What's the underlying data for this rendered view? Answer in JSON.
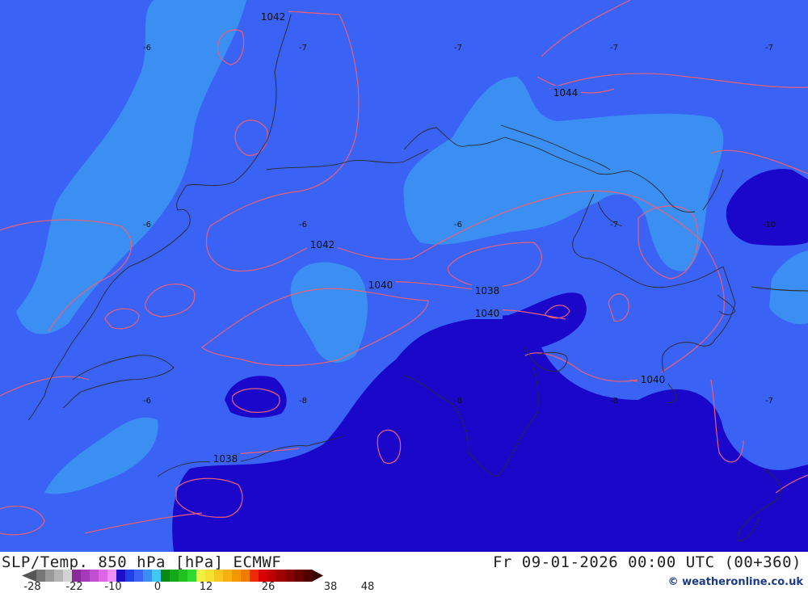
{
  "title_left": "SLP/Temp. 850 hPa [hPa] ECMWF",
  "title_right": "Fr 09-01-2026 00:00 UTC (00+360)",
  "copyright": "© weatheronline.co.uk",
  "colors": {
    "band_minus10_minus6": "#3a62f5",
    "band_minus6_minus4": "#3b8ff2",
    "band_minus12_minus10": "#1a07c9",
    "isobar": "#e8607a",
    "coastline": "#2a2a2a"
  },
  "scale": {
    "colors": [
      "#777777",
      "#999999",
      "#b4b4b4",
      "#d2d2d2",
      "#8a2a9a",
      "#a43ab8",
      "#c24fd2",
      "#dc66e6",
      "#f090f4",
      "#1e0ec8",
      "#2040e6",
      "#3a62f5",
      "#3b8ff2",
      "#40c8f4",
      "#0a8a14",
      "#12a818",
      "#20c020",
      "#30d830",
      "#f0f040",
      "#f6e030",
      "#f8c820",
      "#f8b010",
      "#f49800",
      "#f07c00",
      "#ee2a00",
      "#d80000",
      "#bc0000",
      "#a00000",
      "#860000",
      "#6a0000",
      "#500000"
    ],
    "ticks": [
      "-28",
      "-22",
      "-10",
      "0",
      "12",
      "26",
      "38",
      "48"
    ]
  },
  "isobar_labels": [
    "1042",
    "1044",
    "1042",
    "1040",
    "1038",
    "1040",
    "1040",
    "1038"
  ],
  "temp_labels": [
    "-6",
    "-7",
    "-7",
    "-7",
    "-7",
    "-6",
    "-6",
    "-6",
    "-7",
    "-10",
    "-6",
    "-8",
    "-8",
    "-8",
    "-7"
  ]
}
